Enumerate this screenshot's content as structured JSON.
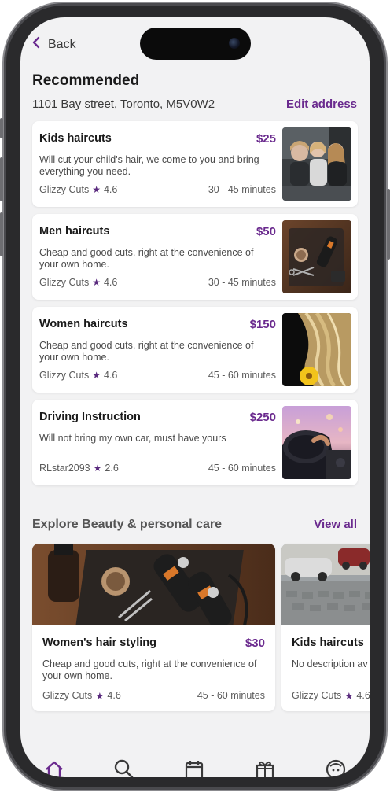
{
  "nav": {
    "back_label": "Back"
  },
  "header": {
    "title": "Recommended",
    "address": "1101 Bay street, Toronto, M5V0W2",
    "edit_address_label": "Edit address"
  },
  "recommended": [
    {
      "name": "Kids haircuts",
      "price": "$25",
      "description": "Will cut your child's hair, we come to you and bring everything you need.",
      "provider": "Glizzy Cuts",
      "rating": "4.6",
      "duration": "30 - 45 minutes"
    },
    {
      "name": "Men haircuts",
      "price": "$50",
      "description": "Cheap and good cuts, right at the convenience of your own home.",
      "provider": "Glizzy Cuts",
      "rating": "4.6",
      "duration": "30 - 45 minutes"
    },
    {
      "name": "Women haircuts",
      "price": "$150",
      "description": "Cheap and good cuts, right at the convenience of your own home.",
      "provider": "Glizzy Cuts",
      "rating": "4.6",
      "duration": "45 - 60 minutes"
    },
    {
      "name": "Driving Instruction",
      "price": "$250",
      "description": "Will not bring my own car, must have yours",
      "provider": "RLstar2093",
      "rating": "2.6",
      "duration": "45 - 60 minutes"
    }
  ],
  "explore": {
    "title": "Explore Beauty & personal care",
    "view_all_label": "View all",
    "cards": [
      {
        "name": "Women's hair styling",
        "price": "$30",
        "description": "Cheap and good cuts, right at the convenience of your own home.",
        "provider": "Glizzy Cuts",
        "rating": "4.6",
        "duration": "45 - 60 minutes"
      },
      {
        "name": "Kids haircuts",
        "price": "",
        "description": "No description av",
        "provider": "Glizzy Cuts",
        "rating": "4.6",
        "duration": ""
      }
    ]
  },
  "star_glyph": "★",
  "tabbar": [
    "home-icon",
    "search-icon",
    "calendar-icon",
    "gift-icon",
    "profile-icon"
  ],
  "colors": {
    "accent": "#6a2a8e",
    "background": "#f2f2f3",
    "card": "#ffffff"
  }
}
